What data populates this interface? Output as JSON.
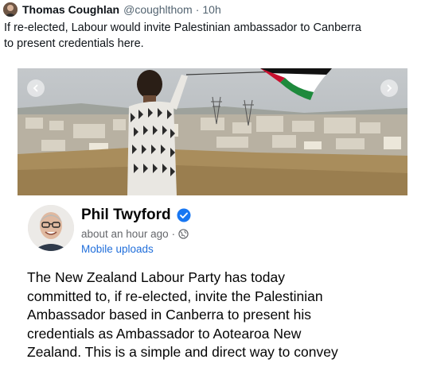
{
  "tweet": {
    "author_name": "Thomas Coughlan",
    "handle": "@coughlthom",
    "separator": "·",
    "time": "10h",
    "text_lines": [
      "If re-elected, Labour would invite Palestinian ambassador to Canberra",
      "to present credentials here."
    ]
  },
  "embedded_post": {
    "carousel": {
      "prev_icon": "chevron-left-icon",
      "next_icon": "chevron-right-icon"
    },
    "poster_name": "Phil Twyford",
    "verified_icon": "verified-badge-icon",
    "time": "about an hour ago",
    "separator": "·",
    "privacy_icon": "globe-icon",
    "album": "Mobile uploads",
    "body_lines": [
      "The New Zealand Labour Party has today",
      "committed to, if re-elected, invite the Palestinian",
      "Ambassador based in Canberra to present his",
      "credentials as Ambassador to Aotearoa New",
      "Zealand. This is a simple and direct way  to convey"
    ]
  },
  "colors": {
    "text_primary": "#0f1419",
    "text_secondary": "#536471",
    "link_blue": "#216fdb",
    "verified_blue": "#1877f2",
    "flag_green": "#1e8a3c",
    "flag_black": "#111111"
  }
}
